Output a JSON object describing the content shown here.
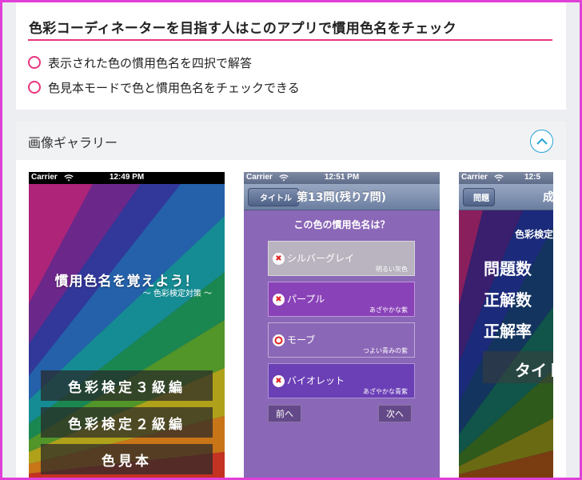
{
  "features": {
    "title": "色彩コーディネーターを目指す人はこのアプリで慣用色名をチェック",
    "items": [
      "表示された色の慣用色名を四択で解答",
      "色見本モードで色と慣用色名をチェックできる"
    ],
    "accent_color": "#e8357d"
  },
  "gallery": {
    "title": "画像ギャラリー",
    "toggle_icon": "chevron-up-icon",
    "accent_color": "#29a3d6",
    "screenshots": [
      {
        "status": {
          "carrier": "Carrier",
          "time": "12:49 PM"
        },
        "title": "慣用色名を覚えよう！",
        "subtitle": "〜 色彩検定対策 〜",
        "buttons": [
          "色彩検定３級編",
          "色彩検定２級編",
          "色見本"
        ]
      },
      {
        "status": {
          "carrier": "Carrier",
          "time": "12:51 PM"
        },
        "back_button": "タイトル",
        "nav_title": "第13問(残り7問)",
        "question": "この色の慣用色名は？",
        "options": [
          {
            "name": "シルバーグレイ",
            "sub": "明るい灰色",
            "mark": "cross"
          },
          {
            "name": "パープル",
            "sub": "あざやかな紫",
            "mark": "cross"
          },
          {
            "name": "モーブ",
            "sub": "つよい青みの紫",
            "mark": "circle"
          },
          {
            "name": "バイオレット",
            "sub": "あざやかな青紫",
            "mark": "cross"
          }
        ],
        "prev_button": "前へ",
        "next_button": "次へ"
      },
      {
        "status": {
          "carrier": "Carrier",
          "time": "12:5"
        },
        "back_button": "問題",
        "nav_title": "成",
        "heading": "色彩検定",
        "rows": [
          "問題数",
          "正解数",
          "正解率"
        ],
        "footer": "タイト"
      }
    ]
  }
}
